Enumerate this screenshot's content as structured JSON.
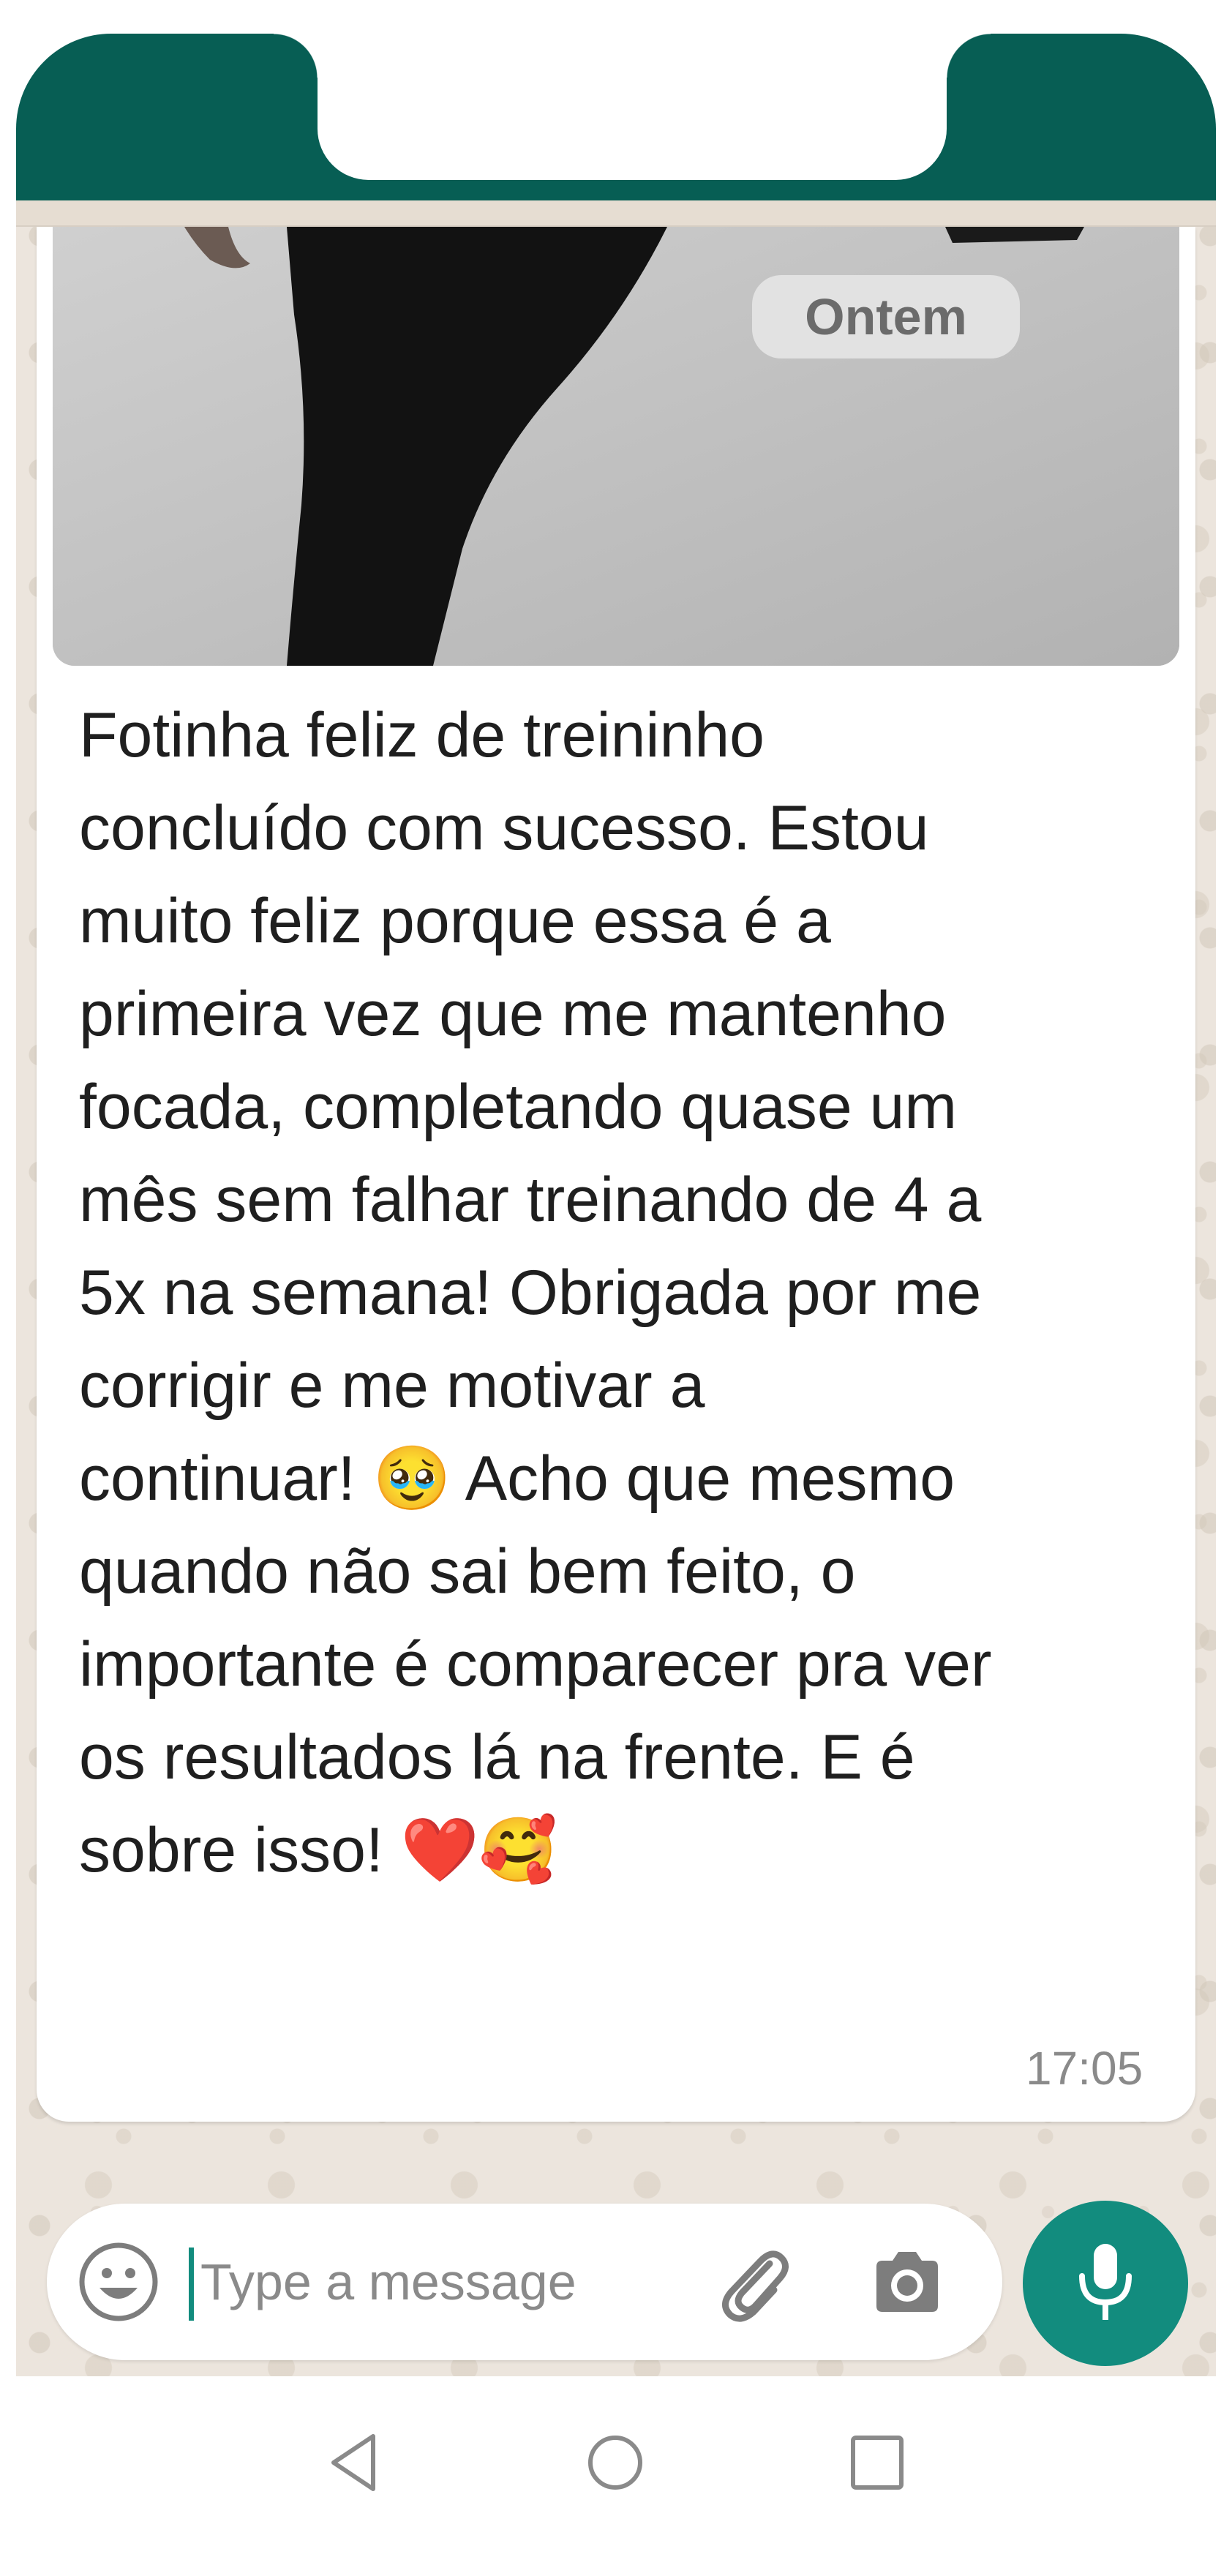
{
  "chat": {
    "date_chip": "Ontem",
    "message": {
      "text": "Fotinha feliz de treininho\nconcluído com sucesso. Estou\nmuito feliz porque essa é a\nprimeira vez que me mantenho\nfocada, completando quase um\nmês sem falhar treinando de 4 a\n5x na semana! Obrigada por me\ncorrigir e me motivar a\ncontinuar! 🥹 Acho que mesmo\nquando não sai bem feito, o\nimportante é comparecer pra ver\nos resultados lá na frente. E é\nsobre isso! ❤️🥰",
      "time": "17:05"
    }
  },
  "composer": {
    "placeholder": "Type a message",
    "emoji_icon": "emoji-icon",
    "attach_icon": "paperclip-icon",
    "camera_icon": "camera-icon",
    "mic_icon": "mic-icon"
  },
  "navbar": {
    "back_icon": "back-triangle-icon",
    "home_icon": "home-circle-icon",
    "recents_icon": "recents-square-icon"
  },
  "colors": {
    "header": "#075e54",
    "accent": "#128c7e",
    "wallpaper": "#ece5dd",
    "bubble": "#ffffff"
  }
}
